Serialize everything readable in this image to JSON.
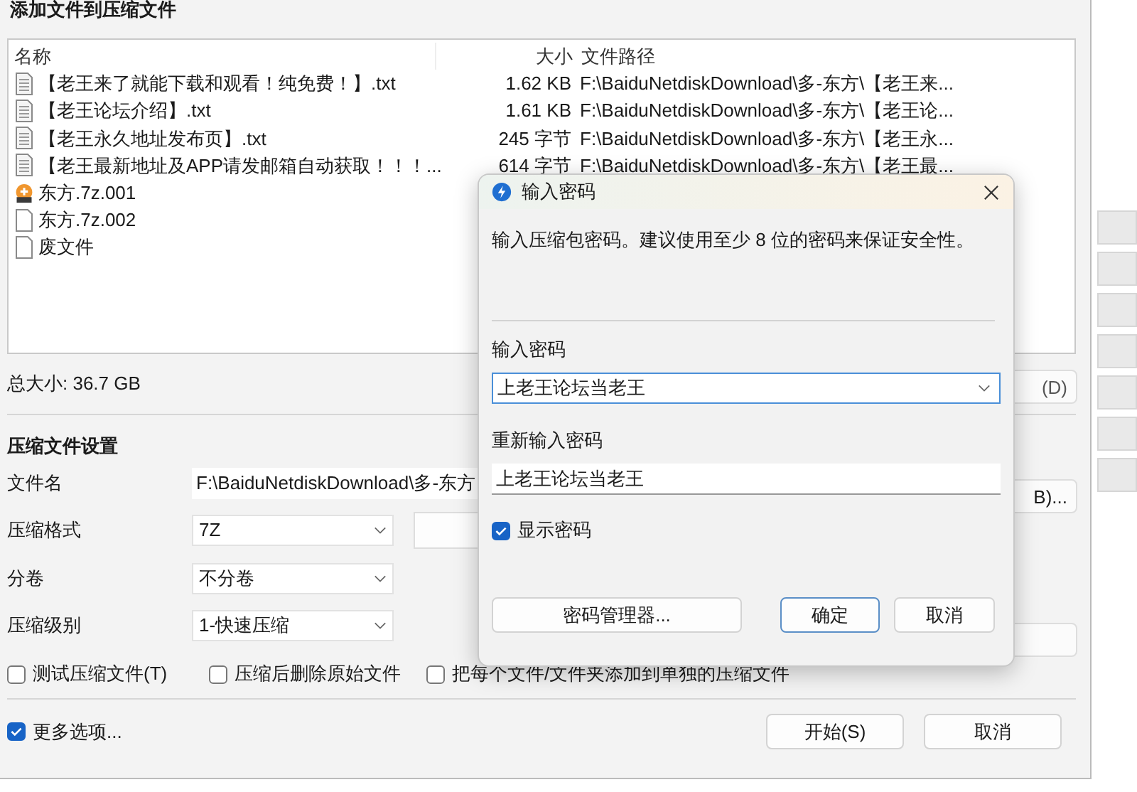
{
  "window": {
    "title": "添加文件到压缩文件"
  },
  "file_list": {
    "columns": [
      "名称",
      "大小",
      "文件路径"
    ],
    "rows": [
      {
        "kind": "text",
        "name": "【老王来了就能下载和观看！纯免费！】.txt",
        "size": "1.62 KB",
        "path": "F:\\BaiduNetdiskDownload\\多-东方\\【老王来..."
      },
      {
        "kind": "text",
        "name": "【老王论坛介绍】.txt",
        "size": "1.61 KB",
        "path": "F:\\BaiduNetdiskDownload\\多-东方\\【老王论..."
      },
      {
        "kind": "text",
        "name": "【老王永久地址发布页】.txt",
        "size": "245 字节",
        "path": "F:\\BaiduNetdiskDownload\\多-东方\\【老王永..."
      },
      {
        "kind": "text",
        "name": "【老王最新地址及APP请发邮箱自动获取！！！...",
        "size": "614 字节",
        "path": "F:\\BaiduNetdiskDownload\\多-东方\\【老王最..."
      },
      {
        "kind": "archive",
        "name": "东方.7z.001"
      },
      {
        "kind": "blank",
        "name": "东方.7z.002"
      },
      {
        "kind": "blank",
        "name": "废文件"
      }
    ]
  },
  "total_size": "总大小: 36.7 GB",
  "settings": {
    "heading": "压缩文件设置",
    "filename_label": "文件名",
    "filename": "F:\\BaiduNetdiskDownload\\多-东方",
    "format_label": "压缩格式",
    "format": "7Z",
    "split_label": "分卷",
    "split": "不分卷",
    "level_label": "压缩级别",
    "level": "1-快速压缩"
  },
  "covered_buttons": [
    "(D)",
    "B)..."
  ],
  "options": [
    {
      "label": "测试压缩文件(T)",
      "checked": false
    },
    {
      "label": "压缩后删除原始文件",
      "checked": false
    },
    {
      "label": "把每个文件/文件夹添加到单独的压缩文件",
      "checked": false
    }
  ],
  "more_options": {
    "label": "更多选项...",
    "checked": true
  },
  "buttons": [
    "开始(S)",
    "取消"
  ],
  "dialog": {
    "title": "输入密码",
    "description": "输入压缩包密码。建议使用至少 8 位的密码来保证安全性。",
    "password_label": "输入密码",
    "password": "上老王论坛当老王",
    "confirm_label": "重新输入密码",
    "confirm": "上老王论坛当老王",
    "show_password": {
      "label": "显示密码",
      "checked": true
    },
    "buttons": [
      {
        "label": "密码管理器...",
        "default": false
      },
      {
        "label": "确定",
        "default": true
      },
      {
        "label": "取消",
        "default": false
      }
    ]
  }
}
